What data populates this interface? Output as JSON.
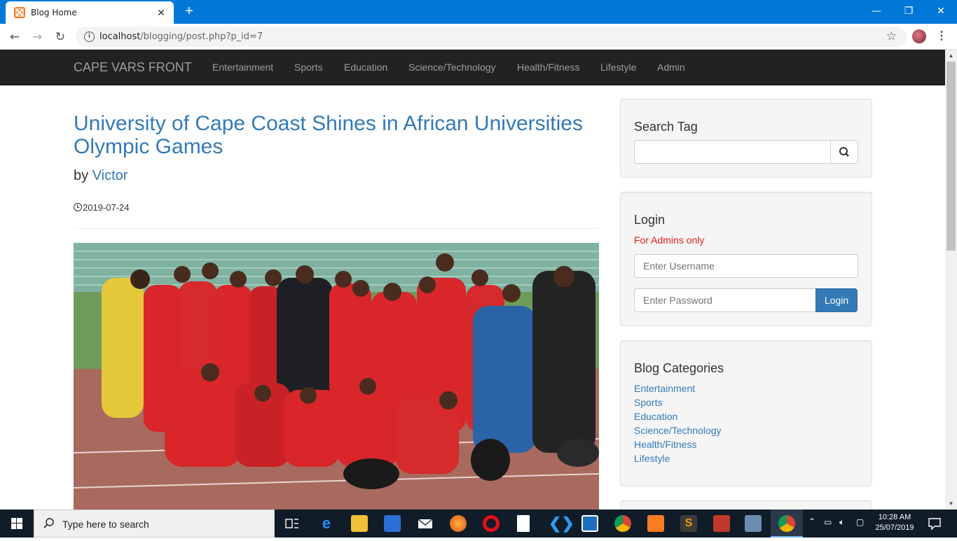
{
  "browser": {
    "tab_title": "Blog Home",
    "url_host": "localhost",
    "url_path": "/blogging/post.php?p_id=7"
  },
  "navbar": {
    "brand": "CAPE VARS FRONT",
    "links": [
      "Entertainment",
      "Sports",
      "Education",
      "Science/Technology",
      "Health/Fitness",
      "Lifestyle",
      "Admin"
    ]
  },
  "post": {
    "title": "University of Cape Coast Shines in African Universities Olympic Games",
    "by_prefix": "by",
    "author": "Victor",
    "date": "2019-07-24"
  },
  "sidebar": {
    "search": {
      "heading": "Search Tag",
      "placeholder": ""
    },
    "login": {
      "heading": "Login",
      "note": "For Admins only",
      "username_placeholder": "Enter Username",
      "password_placeholder": "Enter Password",
      "button": "Login"
    },
    "categories": {
      "heading": "Blog Categories",
      "items": [
        "Entertainment",
        "Sports",
        "Education",
        "Science/Technology",
        "Health/Fitness",
        "Lifestyle"
      ]
    }
  },
  "taskbar": {
    "search_text": "Type here to search",
    "time": "10:28 AM",
    "date": "25/07/2019"
  },
  "colors": {
    "link": "#337ab7",
    "navbar": "#222222",
    "chrome_accent": "#0078d7",
    "warning": "#e01e1e"
  }
}
